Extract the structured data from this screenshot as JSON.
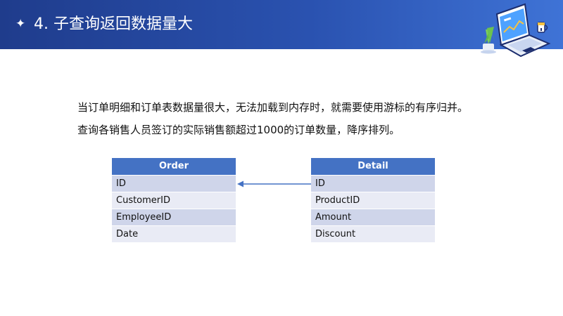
{
  "header": {
    "star_glyph": "✦",
    "title": "4. 子查询返回数据量大"
  },
  "content": {
    "paragraph1": "当订单明细和订单表数据量很大，无法加载到内存时，就需要使用游标的有序归并。",
    "paragraph2": "查询各销售人员签订的实际销售额超过1000的订单数量，降序排列。"
  },
  "tables": {
    "order": {
      "title": "Order",
      "rows": [
        "ID",
        "CustomerID",
        "EmployeeID",
        "Date"
      ]
    },
    "detail": {
      "title": "Detail",
      "rows": [
        "ID",
        "ProductID",
        "Amount",
        "Discount"
      ]
    }
  },
  "colors": {
    "header_start": "#1f3c8c",
    "header_end": "#3f73d6",
    "table_header": "#4472c4",
    "row_odd": "#cfd5ea",
    "row_even": "#e9ebf5",
    "arrow": "#4472c4"
  },
  "icons": {
    "header_illustration": "laptop-with-plant-icon",
    "relation_arrow": "arrow-left-icon"
  }
}
